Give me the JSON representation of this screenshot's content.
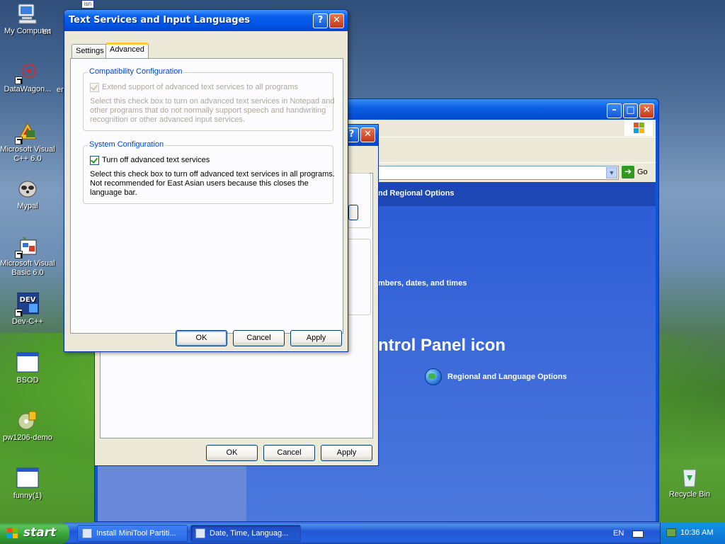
{
  "desktop": {
    "icons": [
      {
        "label": "My Computer"
      },
      {
        "label": "DataWagon..."
      },
      {
        "label": "Microsoft Visual C++ 6.0"
      },
      {
        "label": "Mypal"
      },
      {
        "label": "Microsoft Visual Basic 6.0"
      },
      {
        "label": "Dev-C++"
      },
      {
        "label": "BSOD"
      },
      {
        "label": "pw1206-demo"
      },
      {
        "label": "funny(1)"
      },
      {
        "label": "Recycle Bin"
      }
    ],
    "partial_icon_label": "en",
    "partial_icon_label_2": "en"
  },
  "control_panel": {
    "go_label": "Go",
    "header_text": "nd Regional Options",
    "task_text": "mbers, dates, and times",
    "big_title": "ntrol Panel icon",
    "icon_link": "Regional and Language Options"
  },
  "date_time_dialog": {
    "ok_label": "OK",
    "cancel_label": "Cancel",
    "apply_label": "Apply",
    "help_symbol": "?",
    "close_symbol": "✕"
  },
  "text_services_dialog": {
    "title": "Text Services and Input Languages",
    "help_symbol": "?",
    "close_symbol": "✕",
    "tabs": [
      {
        "label": "Settings",
        "active": false
      },
      {
        "label": "Advanced",
        "active": true
      }
    ],
    "compat_group": {
      "title": "Compatibility Configuration",
      "checkbox_label": "Extend support of advanced text services to all programs",
      "checked": true,
      "enabled": false,
      "description": "Select this check box to turn on advanced text services in Notepad and other programs that do not normally support speech and handwriting recognition or other advanced input services."
    },
    "system_group": {
      "title": "System Configuration",
      "checkbox_label": "Turn off advanced text services",
      "checked": true,
      "enabled": true,
      "description": "Select this check box to turn off advanced text services in all programs. Not recommended for East Asian users because this closes the language bar."
    },
    "ok_label": "OK",
    "cancel_label": "Cancel",
    "apply_label": "Apply"
  },
  "taskbar": {
    "start_label": "start",
    "tasks": [
      {
        "label": "Install MiniTool Partiti...",
        "active": false
      },
      {
        "label": "Date, Time, Languag...",
        "active": true
      }
    ],
    "language": "EN",
    "clock": "10:36 AM"
  }
}
